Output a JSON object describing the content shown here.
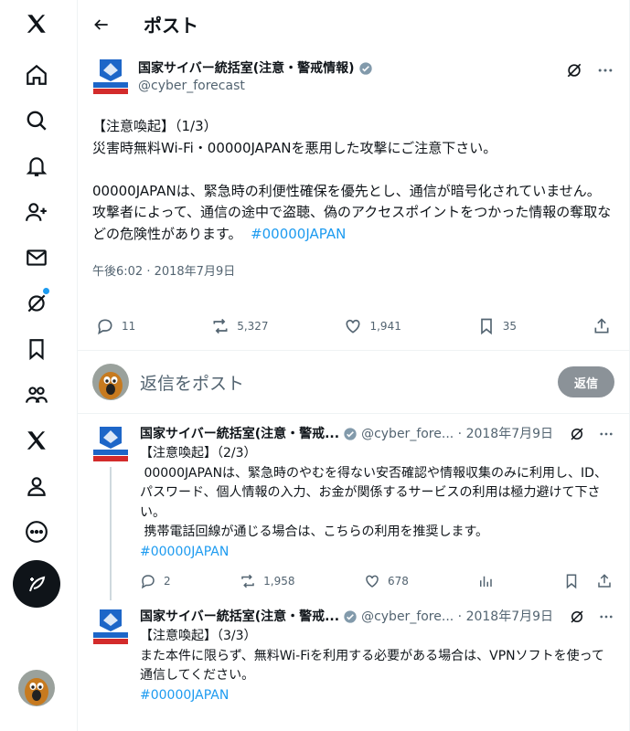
{
  "header": {
    "title": "ポスト"
  },
  "main_post": {
    "author_name": "国家サイバー統括室(注意・警戒情報)",
    "handle": "@cyber_forecast",
    "lines": [
      "【注意喚起】（1/3）",
      "災害時無料Wi-Fi・00000JAPANを悪用した攻撃にご注意下さい。",
      "",
      "00000JAPANは、緊急時の利便性確保を優先とし、通信が暗号化されていません。",
      "攻撃者によって、通信の途中で盗聴、偽のアクセスポイントをつかった情報の奪取などの危険性があります。"
    ],
    "hashtag": "#00000JAPAN",
    "timestamp": "午後6:02 · 2018年7月9日",
    "stats": {
      "replies": "11",
      "reposts": "5,327",
      "likes": "1,941",
      "bookmarks": "35"
    }
  },
  "reply_box": {
    "placeholder": "返信をポスト",
    "button_label": "返信"
  },
  "thread": [
    {
      "author_name": "国家サイバー統括室(注意・警戒...",
      "meta": "@cyber_fore... · 2018年7月9日",
      "text": "【注意喚起】（2/3）\n 00000JAPANは、緊急時のやむを得ない安否確認や情報収集のみに利用し、ID、パスワード、個人情報の入力、お金が関係するサービスの利用は極力避けて下さい。\n 携帯電話回線が通じる場合は、こちらの利用を推奨します。",
      "hashtag": "#00000JAPAN",
      "replies": "2",
      "reposts": "1,958",
      "likes": "678"
    },
    {
      "author_name": "国家サイバー統括室(注意・警戒...",
      "meta": "@cyber_fore... · 2018年7月9日",
      "text": "【注意喚起】（3/3）\nまた本件に限らず、無料Wi-Fiを利用する必要がある場合は、VPNソフトを使って通信してください。",
      "hashtag": "#00000JAPAN"
    }
  ],
  "logo_text": "国家サイバー統括室 注意・警戒情報",
  "colors": {
    "accent": "#1d9bf0",
    "text": "#0f1419",
    "muted": "#536471",
    "reply_button": "#8b9298"
  },
  "icons": [
    "x-logo-icon",
    "home-icon",
    "search-icon",
    "bell-icon",
    "add-user-icon",
    "mail-icon",
    "grok-icon",
    "bookmark-icon",
    "communities-icon",
    "premium-x-icon",
    "profile-icon",
    "more-icon",
    "compose-post-icon"
  ]
}
